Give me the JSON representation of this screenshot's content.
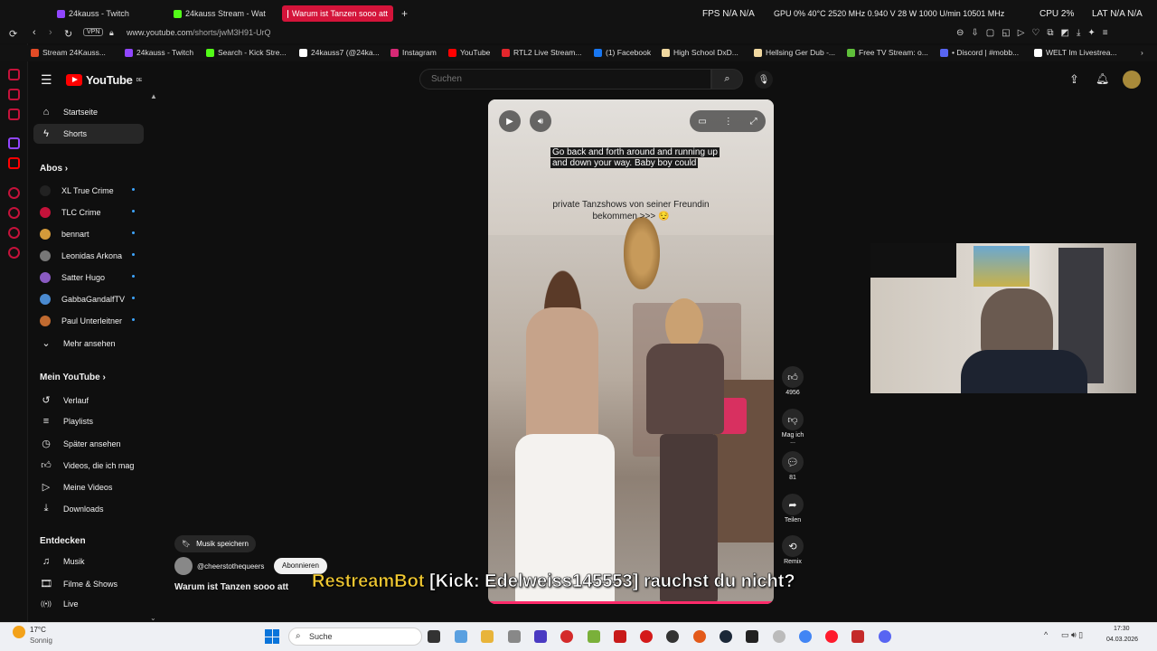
{
  "browser": {
    "tabs": [
      {
        "label": "24kauss - Twitch"
      },
      {
        "label": "24kauss Stream - Wat"
      },
      {
        "label": "Warum ist Tanzen sooo att"
      }
    ],
    "stats": {
      "fps": "FPS N/A N/A",
      "gpu": "GPU 0% 40°C 2520 MHz 0.940 V 28 W 1000 U/min 10501 MHz",
      "cpu": "CPU 2%",
      "lat": "LAT N/A N/A"
    },
    "vpn_badge": "VPN",
    "url_host": "www.youtube.com",
    "url_path": "/shorts/jwM3H91-UrQ",
    "bookmarks": [
      {
        "label": "Stream 24Kauss...",
        "color": "#e34b26"
      },
      {
        "label": "24kauss - Twitch",
        "color": "#9146ff"
      },
      {
        "label": "Search - Kick Stre...",
        "color": "#53fc18"
      },
      {
        "label": "24kauss7 (@24ka...",
        "color": "#ffffff"
      },
      {
        "label": "Instagram",
        "color": "#d62976"
      },
      {
        "label": "YouTube",
        "color": "#ff0000"
      },
      {
        "label": "RTL2 Live Stream...",
        "color": "#e3262c"
      },
      {
        "label": "(1) Facebook",
        "color": "#1877f2"
      },
      {
        "label": "High School DxD...",
        "color": "#f0d8a0"
      },
      {
        "label": "Hellsing Ger Dub -...",
        "color": "#f0d8a0"
      },
      {
        "label": "Free TV Stream: o...",
        "color": "#5fbf3a"
      },
      {
        "label": "• Discord | #mobb...",
        "color": "#5865f2"
      },
      {
        "label": "WELT Im Livestrea...",
        "color": "#ffffff"
      }
    ]
  },
  "youtube": {
    "logo_text": "YouTube",
    "logo_region": "DE",
    "search_placeholder": "Suchen",
    "nav": [
      {
        "label": "Startseite",
        "icon": "home-icon"
      },
      {
        "label": "Shorts",
        "icon": "shorts-icon"
      }
    ],
    "abos_title": "Abos",
    "subscriptions": [
      {
        "label": "XL True Crime",
        "color": "#222"
      },
      {
        "label": "TLC Crime",
        "color": "#c4123a"
      },
      {
        "label": "bennart",
        "color": "#d49a3a"
      },
      {
        "label": "Leonidas Arkona",
        "color": "#777"
      },
      {
        "label": "Satter Hugo",
        "color": "#8a5ac2"
      },
      {
        "label": "GabbaGandalfTV",
        "color": "#4a8ad0"
      },
      {
        "label": "Paul Unterleitner",
        "color": "#c06a30"
      }
    ],
    "more_label": "Mehr ansehen",
    "mein_title": "Mein YouTube",
    "mein_items": [
      {
        "label": "Verlauf",
        "icon": "history-icon"
      },
      {
        "label": "Playlists",
        "icon": "playlist-icon"
      },
      {
        "label": "Später ansehen",
        "icon": "clock-icon"
      },
      {
        "label": "Videos, die ich mag",
        "icon": "thumbs-up-icon"
      },
      {
        "label": "Meine Videos",
        "icon": "video-icon"
      },
      {
        "label": "Downloads",
        "icon": "download-icon"
      }
    ],
    "entdecken_title": "Entdecken",
    "entdecken_items": [
      {
        "label": "Musik",
        "icon": "music-icon"
      },
      {
        "label": "Filme & Shows",
        "icon": "film-icon"
      },
      {
        "label": "Live",
        "icon": "live-icon"
      }
    ]
  },
  "short": {
    "caption_top_line1": "Go back and forth around and running up",
    "caption_top_line2": "and down your way. Baby boy could",
    "caption_text": "private Tanzshows von seiner Freundin bekommen >>> 😌",
    "like_count": "4956",
    "dislike_label": "Mag ich ...",
    "comment_count": "81",
    "share_label": "Teilen",
    "remix_label": "Remix",
    "musik_label": "Musik speichern",
    "channel": "@cheerstothequeers",
    "subscribe_label": "Abonnieren",
    "title": "Warum ist Tanzen sooo att"
  },
  "chat": {
    "user": "RestreamBot",
    "message": "[Kick: Edelweiss145553] rauchst du nicht?"
  },
  "taskbar": {
    "weather_temp": "17°C",
    "weather_desc": "Sonnig",
    "search_label": "Suche",
    "time": "17:30",
    "date": "04.03.2026"
  }
}
